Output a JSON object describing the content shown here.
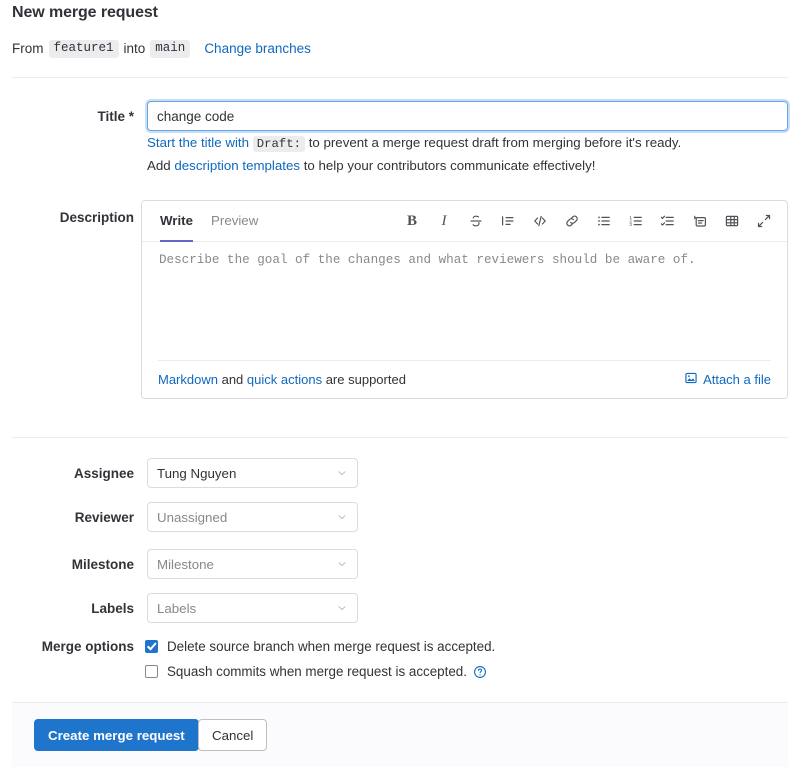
{
  "header": {
    "title": "New merge request",
    "from_label": "From",
    "source_branch": "feature1",
    "into_label": "into",
    "target_branch": "main",
    "change_branches_link": "Change branches"
  },
  "title_field": {
    "label": "Title *",
    "value": "change code",
    "hint1_link": "Start the title with",
    "hint1_code": "Draft:",
    "hint1_rest": "to prevent a merge request draft from merging before it's ready.",
    "hint2_pre": "Add",
    "hint2_link": "description templates",
    "hint2_rest": "to help your contributors communicate effectively!"
  },
  "description": {
    "label": "Description",
    "tab_write": "Write",
    "tab_preview": "Preview",
    "placeholder": "Describe the goal of the changes and what reviewers should be aware of.",
    "value": "",
    "toolbar": [
      {
        "name": "bold-icon",
        "title": "Bold"
      },
      {
        "name": "italic-icon",
        "title": "Italic"
      },
      {
        "name": "strikethrough-icon",
        "title": "Strikethrough"
      },
      {
        "name": "quote-icon",
        "title": "Insert a quote"
      },
      {
        "name": "code-icon",
        "title": "Insert code"
      },
      {
        "name": "link-icon",
        "title": "Insert a link"
      },
      {
        "name": "bullet-list-icon",
        "title": "Add a bullet list"
      },
      {
        "name": "numbered-list-icon",
        "title": "Add a numbered list"
      },
      {
        "name": "task-list-icon",
        "title": "Add a checklist"
      },
      {
        "name": "collapsible-section-icon",
        "title": "Add a collapsible section"
      },
      {
        "name": "table-icon",
        "title": "Add a table"
      },
      {
        "name": "fullscreen-icon",
        "title": "Go full screen"
      }
    ],
    "footer_markdown_link": "Markdown",
    "footer_and": "and",
    "footer_quick_actions_link": "quick actions",
    "footer_supported": "are supported",
    "attach_label": "Attach a file"
  },
  "fields": [
    {
      "label": "Assignee",
      "value": "Tung Nguyen",
      "filled": true
    },
    {
      "label": "Reviewer",
      "value": "Unassigned",
      "filled": false
    },
    {
      "label": "Milestone",
      "value": "Milestone",
      "filled": false
    },
    {
      "label": "Labels",
      "value": "Labels",
      "filled": false
    }
  ],
  "merge_options": {
    "label": "Merge options",
    "delete_source_branch": {
      "text": "Delete source branch when merge request is accepted.",
      "checked": true
    },
    "squash_commits": {
      "text": "Squash commits when merge request is accepted.",
      "checked": false
    }
  },
  "footer": {
    "submit_label": "Create merge request",
    "cancel_label": "Cancel"
  },
  "colors": {
    "primary_blue": "#1f75cb",
    "link_blue": "#1068bf",
    "active_tab_underline": "#6666c4",
    "border_gray": "#dcdcde",
    "footer_bg": "#fbfafd"
  }
}
